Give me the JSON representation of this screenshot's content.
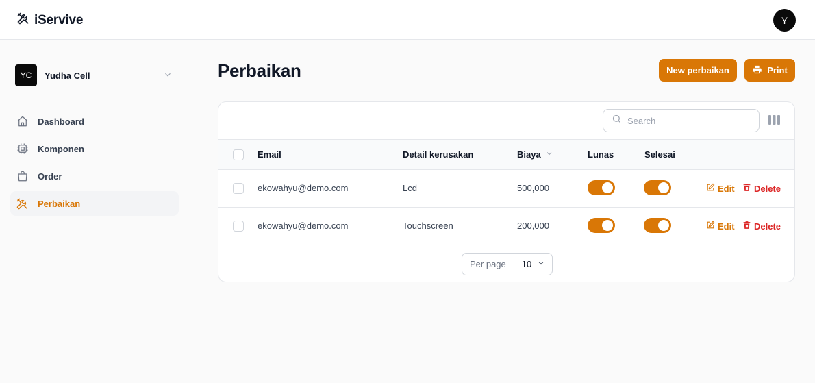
{
  "app": {
    "name": "iServive",
    "user_initial": "Y"
  },
  "tenant": {
    "initials": "YC",
    "name": "Yudha Cell"
  },
  "nav": {
    "items": [
      {
        "label": "Dashboard",
        "icon": "home-icon",
        "active": false
      },
      {
        "label": "Komponen",
        "icon": "cpu-chip-icon",
        "active": false
      },
      {
        "label": "Order",
        "icon": "shopping-bag-icon",
        "active": false
      },
      {
        "label": "Perbaikan",
        "icon": "wrench-screwdriver-icon",
        "active": true
      }
    ]
  },
  "page": {
    "title": "Perbaikan",
    "new_button": "New perbaikan",
    "print_button": "Print"
  },
  "search": {
    "placeholder": "Search"
  },
  "table": {
    "columns": {
      "email": "Email",
      "detail": "Detail kerusakan",
      "biaya": "Biaya",
      "lunas": "Lunas",
      "selesai": "Selesai"
    },
    "rows": [
      {
        "email": "ekowahyu@demo.com",
        "detail": "Lcd",
        "biaya": "500,000",
        "lunas": true,
        "selesai": true
      },
      {
        "email": "ekowahyu@demo.com",
        "detail": "Touchscreen",
        "biaya": "200,000",
        "lunas": true,
        "selesai": true
      }
    ],
    "actions": {
      "edit": "Edit",
      "delete": "Delete"
    }
  },
  "pagination": {
    "per_page_label": "Per page",
    "per_page_value": "10"
  },
  "colors": {
    "accent": "#d97706",
    "danger": "#dc2626",
    "dark": "#0a0a0a"
  }
}
